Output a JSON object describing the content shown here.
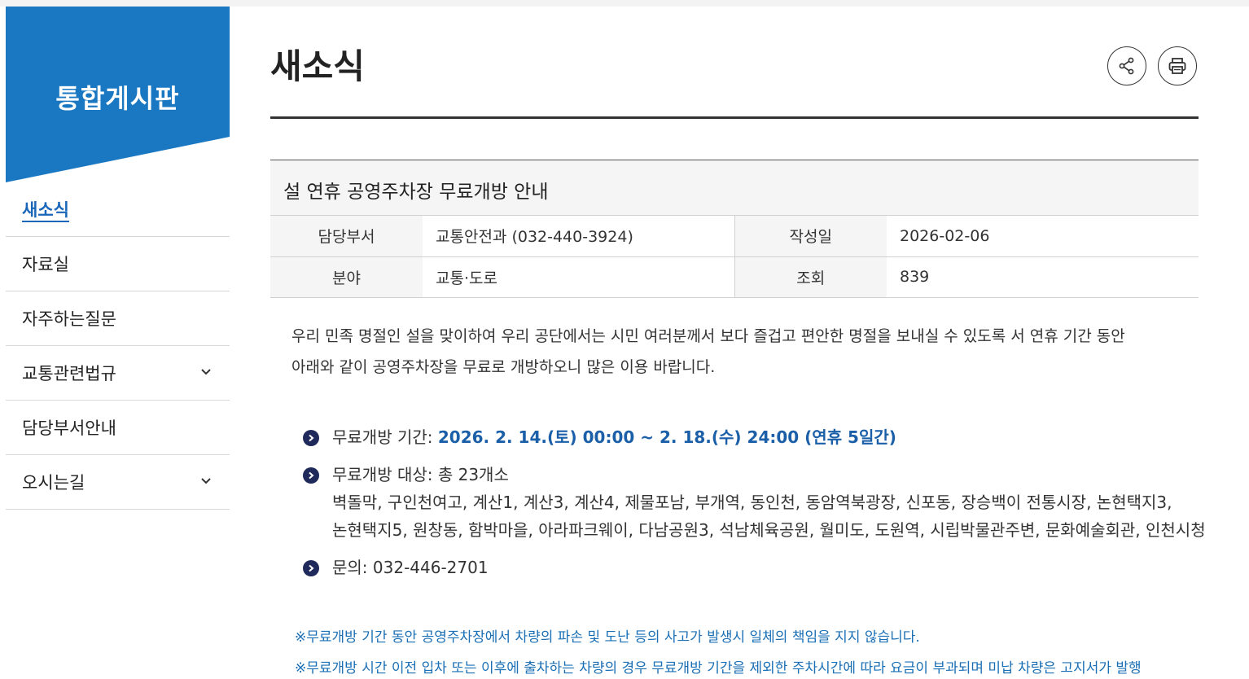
{
  "sidebar": {
    "title": "통합게시판",
    "items": [
      {
        "label": "새소식",
        "active": true,
        "has_children": false
      },
      {
        "label": "자료실",
        "active": false,
        "has_children": false
      },
      {
        "label": "자주하는질문",
        "active": false,
        "has_children": false
      },
      {
        "label": "교통관련법규",
        "active": false,
        "has_children": true
      },
      {
        "label": "담당부서안내",
        "active": false,
        "has_children": false
      },
      {
        "label": "오시는길",
        "active": false,
        "has_children": true
      }
    ]
  },
  "page": {
    "title": "새소식",
    "share_icon": "share-icon",
    "print_icon": "print-icon"
  },
  "post": {
    "title": "설 연휴 공영주차장 무료개방 안내",
    "meta": {
      "dept_label": "담당부서",
      "dept_value": "교통안전과 (032-440-3924)",
      "date_label": "작성일",
      "date_value": "2026-02-06",
      "field_label": "분야",
      "field_value": "교통·도로",
      "views_label": "조회",
      "views_value": "839"
    },
    "intro_line1": "우리 민족 명절인 설을 맞이하여 우리 공단에서는 시민 여러분께서 보다 즐겁고 편안한 명절을 보내실 수 있도록 서 연휴 기간 동안",
    "intro_line2": "아래와 같이 공영주차장을 무료로 개방하오니 많은 이용 바랍니다.",
    "period_label": "무료개방 기간: ",
    "period_value": "2026. 2. 14.(토) 00:00 ~ 2. 18.(수) 24:00 (연휴 5일간)",
    "target_label": "무료개방 대상: 총 23개소",
    "target_line1": "벽돌막, 구인천여고, 계산1, 계산3, 계산4, 제물포남, 부개역, 동인천, 동암역북광장, 신포동, 장승백이 전통시장, 논현택지3,",
    "target_line2": "논현택지5, 원창동, 함박마을, 아라파크웨이, 다남공원3, 석남체육공원, 월미도, 도원역, 시립박물관주변, 문화예술회관, 인천시청",
    "contact": "문의: 032-446-2701",
    "note1": "※무료개방 기간 동안 공영주차장에서 차량의 파손 및 도난 등의 사고가 발생시 일체의 책임을 지지 않습니다.",
    "note2": "※무료개방 시간 이전 입차 또는 이후에 출차하는 차량의 경우 무료개방 기간을 제외한 주차시간에 따라 요금이 부과되며 미납 차량은 고지서가 발행"
  },
  "colors": {
    "brand_blue": "#1a78c2",
    "link_blue": "#1a66b8",
    "bullet_navy": "#1f2a5a"
  }
}
